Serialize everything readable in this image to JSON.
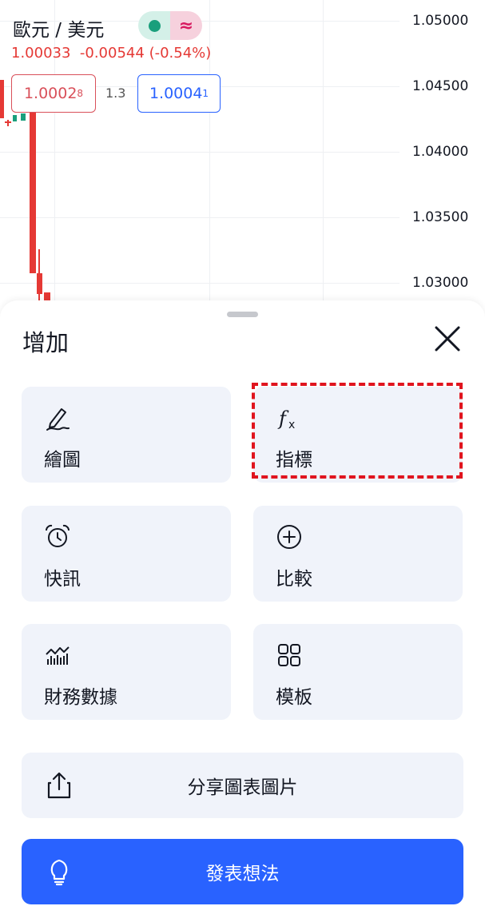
{
  "chart": {
    "symbol": "歐元 / 美元",
    "price": "1.00033",
    "change": "-0.00544",
    "change_pct": "(-0.54%)",
    "sell_price_main": "1.0002",
    "sell_price_sup": "8",
    "spread": "1.3",
    "buy_price_main": "1.0004",
    "buy_price_sup": "1",
    "y_ticks": [
      "1.05000",
      "1.04500",
      "1.04000",
      "1.03500",
      "1.03000"
    ],
    "colors": {
      "up": "#1a9f7c",
      "down": "#e53935",
      "accent": "#2962ff"
    }
  },
  "sheet": {
    "title": "增加",
    "tiles": [
      {
        "label": "繪圖",
        "icon": "pen-icon"
      },
      {
        "label": "指標",
        "icon": "function-icon"
      },
      {
        "label": "快訊",
        "icon": "alarm-clock-icon"
      },
      {
        "label": "比較",
        "icon": "plus-circle-icon"
      },
      {
        "label": "財務數據",
        "icon": "financials-chart-icon"
      },
      {
        "label": "模板",
        "icon": "grid-icon"
      }
    ],
    "share_label": "分享圖表圖片",
    "publish_label": "發表想法"
  }
}
